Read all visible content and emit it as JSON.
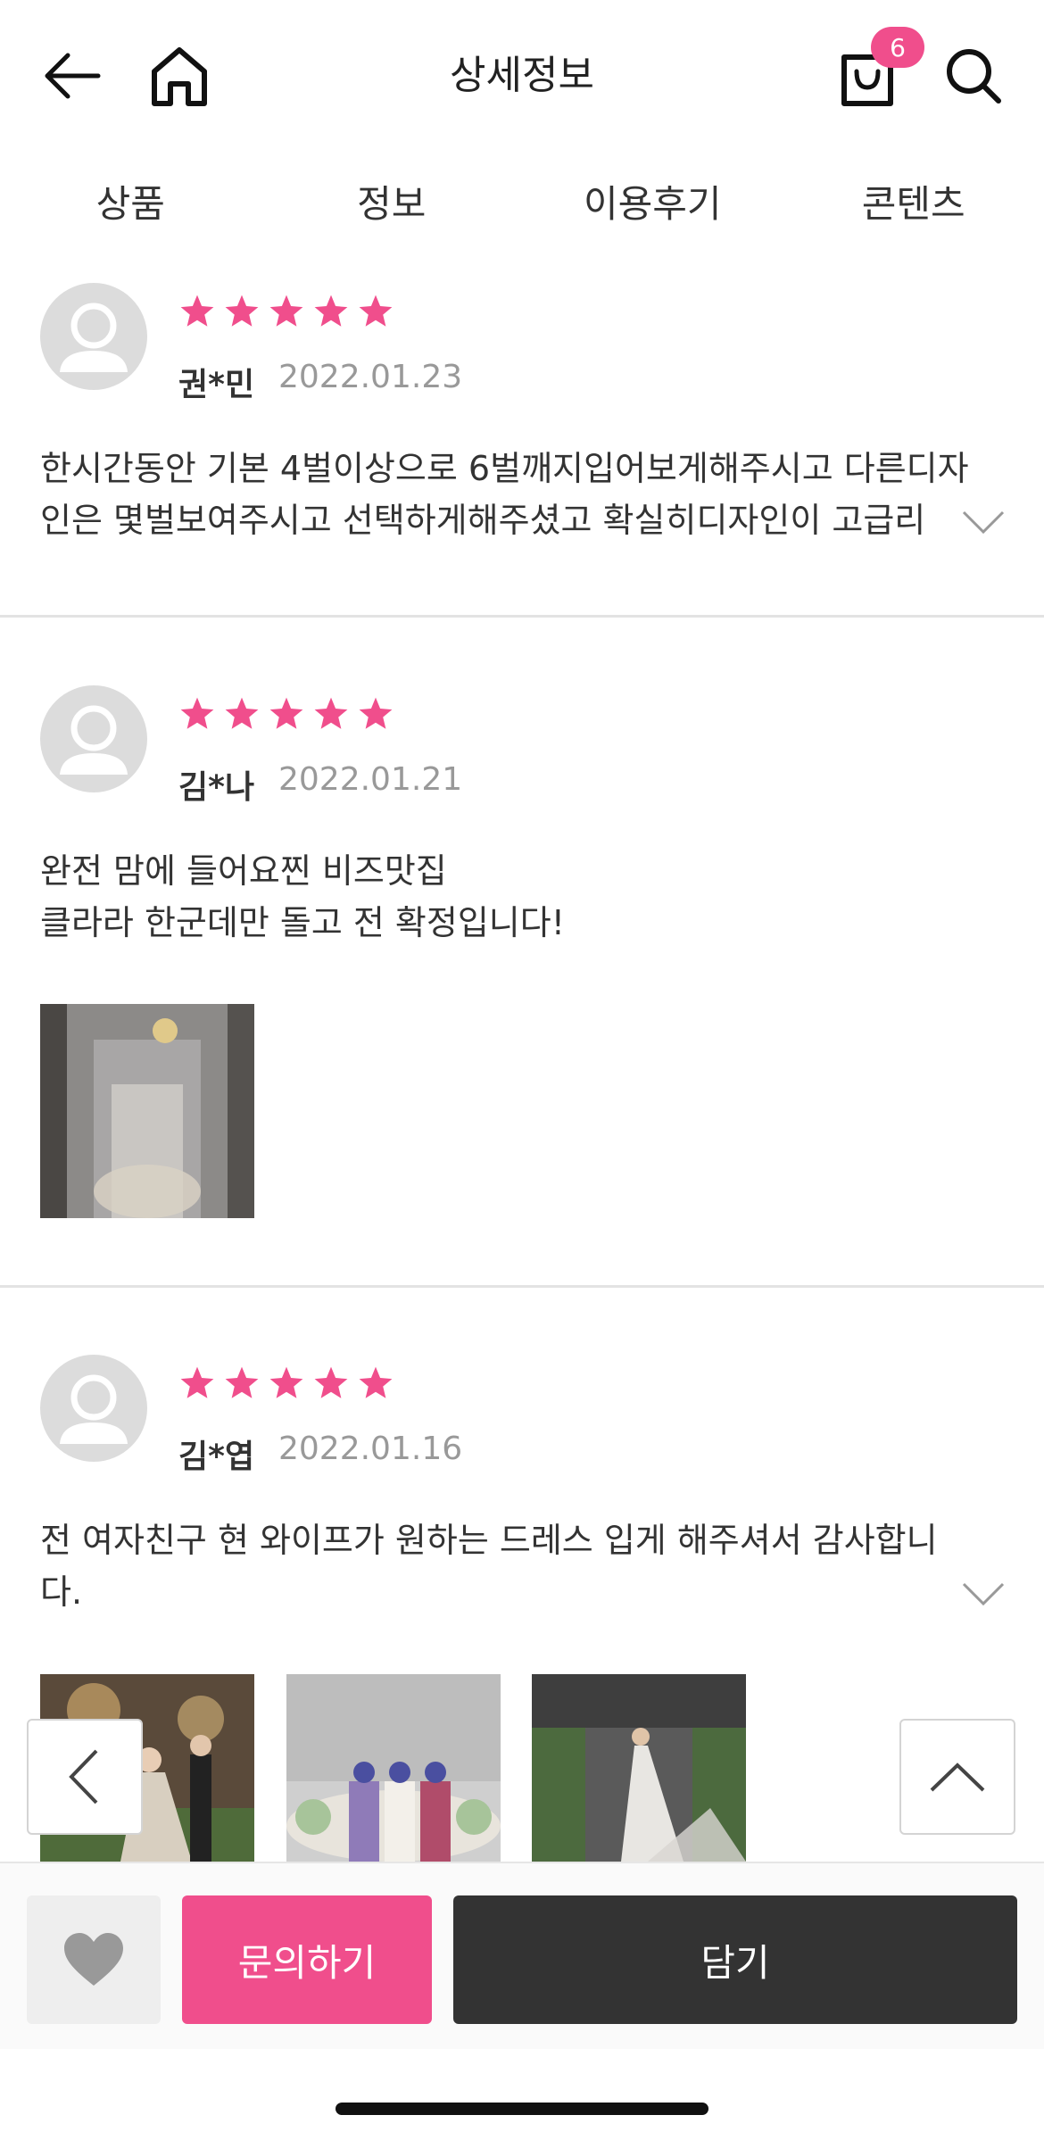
{
  "header": {
    "title": "상세정보",
    "cart_count": "6"
  },
  "tabs": [
    {
      "label": "상품"
    },
    {
      "label": "정보"
    },
    {
      "label": "이용후기"
    },
    {
      "label": "콘텐츠"
    }
  ],
  "reviews": [
    {
      "rating": 5,
      "name": "권*민",
      "date": "2022.01.23",
      "text": "한시간동안 기본 4벌이상으로 6벌깨지입어보게해주시고 다른디자인은 몇벌보여주시고 선택하게해주셨고 확실히디자인이 고급리"
    },
    {
      "rating": 5,
      "name": "김*나",
      "date": "2022.01.21",
      "text": "완전 맘에 들어요찐 비즈맛집\n클라라 한군데만 돌고 전 확정입니다!"
    },
    {
      "rating": 5,
      "name": "김*엽",
      "date": "2022.01.16",
      "text": "전 여자친구 현 와이프가 원하는 드레스 입게 해주셔서 감사합니다."
    }
  ],
  "bottom_bar": {
    "inquiry_label": "문의하기",
    "cart_label": "담기"
  },
  "colors": {
    "accent_pink": "#f04e8c",
    "dark_button": "#333333",
    "star": "#f04e8c"
  }
}
